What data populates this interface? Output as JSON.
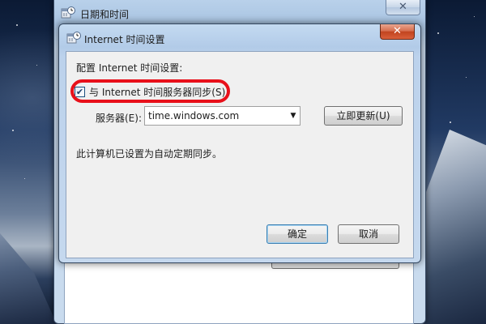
{
  "background_window": {
    "title": "日期和时间",
    "close_symbol": "✕",
    "icon": "datetime-icon"
  },
  "dialog": {
    "title": "Internet 时间设置",
    "close_symbol": "✕",
    "icon": "datetime-icon",
    "section_label": "配置 Internet 时间设置:",
    "sync_checkbox": {
      "label": "与 Internet 时间服务器同步(S)",
      "checked": true,
      "mark": "✔"
    },
    "server": {
      "label": "服务器(E):",
      "value": "time.windows.com",
      "arrow": "▼"
    },
    "update_button": "立即更新(U)",
    "status_text": "此计算机已设置为自动定期同步。",
    "ok_button": "确定",
    "cancel_button": "取消"
  },
  "colors": {
    "highlight_ring": "#e8101a",
    "close_button_red": "#c2441f",
    "titlebar_blue": "#b2cbe8",
    "client_bg": "#f0f0f0"
  }
}
